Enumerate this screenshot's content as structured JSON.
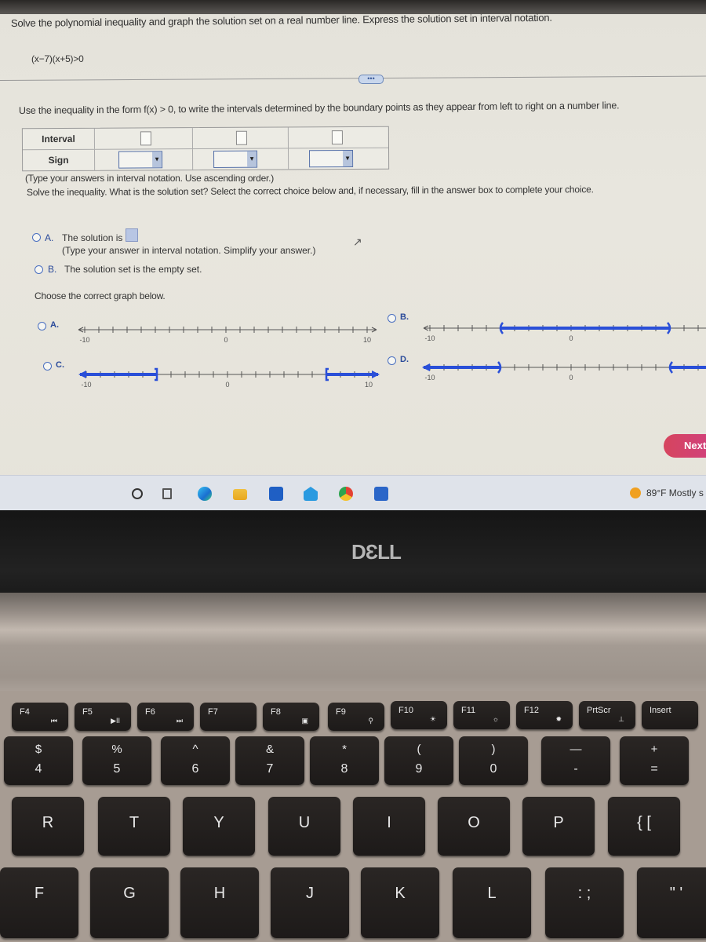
{
  "question": {
    "title": "Solve the polynomial inequality and graph the solution set on a real number line. Express the solution set in interval notation.",
    "inequality": "(x−7)(x+5)>0",
    "more_button": "•••",
    "instruction": "Use the inequality in the form f(x) > 0, to write the intervals determined by the boundary points as they appear from left to right on a number line.",
    "table": {
      "row_labels": [
        "Interval",
        "Sign"
      ],
      "interval_values": [
        "",
        "",
        ""
      ],
      "sign_values": [
        "",
        "",
        ""
      ],
      "dropdown_arrow": "▼"
    },
    "table_hint": "(Type your answers in interval notation. Use ascending order.)",
    "solve_prompt": "Solve the inequality. What is the solution set? Select the correct choice below and, if necessary, fill in the answer box to complete your choice.",
    "choices": [
      {
        "letter": "A.",
        "text": "The solution is",
        "hint": "(Type your answer in interval notation. Simplify your answer.)",
        "answer": ""
      },
      {
        "letter": "B.",
        "text": "The solution set is the empty set."
      }
    ],
    "graph_prompt": "Choose the correct graph below.",
    "graph_options": [
      {
        "letter": "A.",
        "shading": "none"
      },
      {
        "letter": "B.",
        "shading": "(-5, 7)"
      },
      {
        "letter": "C.",
        "shading": "(-∞, -5] ∪ [7, ∞)"
      },
      {
        "letter": "D.",
        "shading": "(-∞, -5) ∪ (7, ∞)"
      }
    ],
    "next_button": "Next"
  },
  "number_lines": {
    "min": -10,
    "max": 10,
    "step": 1,
    "labels": [
      "-10",
      "0",
      "10"
    ],
    "shade_color": "#2a4fd8",
    "graphs": [
      {
        "id": "A",
        "segments": []
      },
      {
        "id": "B",
        "segments": [
          {
            "from": -5,
            "to": 7,
            "left": "(",
            "right": ")"
          }
        ]
      },
      {
        "id": "C",
        "segments": [
          {
            "from": "-inf",
            "to": -5,
            "right": "]"
          },
          {
            "from": 7,
            "to": "inf",
            "left": "["
          }
        ]
      },
      {
        "id": "D",
        "segments": [
          {
            "from": "-inf",
            "to": -5,
            "right": ")"
          },
          {
            "from": 7,
            "to": "inf",
            "left": "("
          }
        ]
      }
    ]
  },
  "taskbar": {
    "icons": [
      "search-icon",
      "task-view-icon",
      "edge-icon",
      "file-explorer-icon",
      "store-icon",
      "mail-icon",
      "chrome-icon",
      "word-icon"
    ],
    "weather": "89°F  Mostly s"
  },
  "laptop": {
    "brand": "DƐLL",
    "function_keys": [
      {
        "label": "F4",
        "sub": "⏮"
      },
      {
        "label": "F5",
        "sub": "▶II"
      },
      {
        "label": "F6",
        "sub": "⏭"
      },
      {
        "label": "F7",
        "sub": ""
      },
      {
        "label": "F8",
        "sub": "▣"
      },
      {
        "label": "F9",
        "sub": "⚲"
      },
      {
        "label": "F10",
        "sub": "☀"
      },
      {
        "label": "F11",
        "sub": "☼"
      },
      {
        "label": "F12",
        "sub": "✹"
      },
      {
        "label": "PrtScr",
        "sub": "⊥"
      },
      {
        "label": "Insert",
        "sub": ""
      }
    ],
    "number_keys": [
      {
        "top": "$",
        "bottom": "4"
      },
      {
        "top": "%",
        "bottom": "5"
      },
      {
        "top": "^",
        "bottom": "6"
      },
      {
        "top": "&",
        "bottom": "7"
      },
      {
        "top": "*",
        "bottom": "8"
      },
      {
        "top": "(",
        "bottom": "9"
      },
      {
        "top": ")",
        "bottom": "0"
      },
      {
        "top": "—",
        "bottom": "-"
      },
      {
        "top": "+",
        "bottom": "="
      }
    ],
    "row_qwerty": [
      "R",
      "T",
      "Y",
      "U",
      "I",
      "O",
      "P",
      "{ ["
    ],
    "row_asdf": [
      "F",
      "G",
      "H",
      "J",
      "K",
      "L",
      ": ;",
      "\" '"
    ]
  }
}
